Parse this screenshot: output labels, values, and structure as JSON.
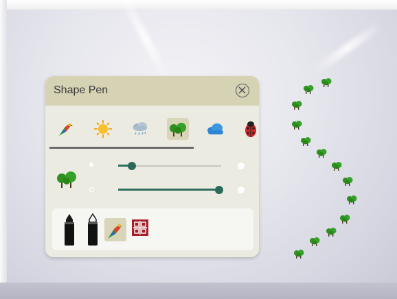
{
  "panel": {
    "title": "Shape Pen",
    "close_icon": "close-circle-icon"
  },
  "brushes": [
    {
      "name": "bird-brush",
      "icon": "parrot-icon",
      "selected": false
    },
    {
      "name": "sun-brush",
      "icon": "sun-icon",
      "selected": false
    },
    {
      "name": "rain-cloud-brush",
      "icon": "rain-cloud-icon",
      "selected": false
    },
    {
      "name": "tree-brush",
      "icon": "tree-icon",
      "selected": true
    },
    {
      "name": "cloud-brush",
      "icon": "cloud-icon",
      "selected": false
    },
    {
      "name": "ladybug-brush",
      "icon": "ladybug-icon",
      "selected": false
    }
  ],
  "sliders": {
    "size": {
      "value": 0.13
    },
    "opacity": {
      "value": 0.98
    }
  },
  "tools": [
    {
      "name": "marker-tool",
      "icon": "marker-icon"
    },
    {
      "name": "marker-outline-tool",
      "icon": "marker-outline-icon"
    },
    {
      "name": "image-stamp-tool",
      "icon": "parrot-stamp-icon",
      "selected": true
    },
    {
      "name": "pattern-tool",
      "icon": "pattern-tile-icon"
    }
  ],
  "colors": {
    "accent": "#2b6a59",
    "header": "#d6d2b4",
    "panel": "#ecebe1",
    "tree_green": "#2f8f1f"
  }
}
